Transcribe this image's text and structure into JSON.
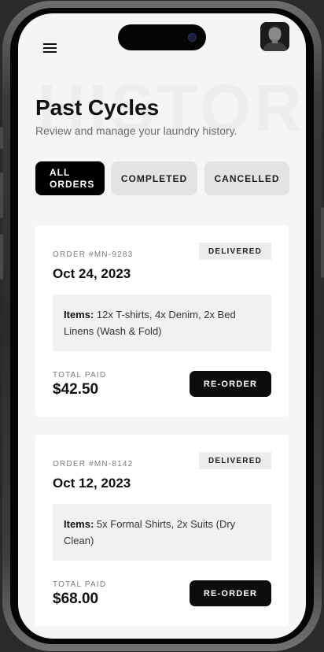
{
  "header": {
    "watermark": "HISTOR",
    "title": "Past Cycles",
    "subtitle": "Review and manage your laundry history."
  },
  "tabs": [
    {
      "label": "ALL\nORDERS",
      "active": true
    },
    {
      "label": "COMPLETED",
      "active": false
    },
    {
      "label": "CANCELLED",
      "active": false
    }
  ],
  "orders": [
    {
      "order_number": "ORDER #MN-9283",
      "status": "DELIVERED",
      "date": "Oct 24, 2023",
      "items_label": "Items:",
      "items": "12x T-shirts, 4x Denim, 2x Bed Linens (Wash & Fold)",
      "total_label": "TOTAL PAID",
      "total": "$42.50",
      "action": "RE-ORDER"
    },
    {
      "order_number": "ORDER #MN-8142",
      "status": "DELIVERED",
      "date": "Oct 12, 2023",
      "items_label": "Items:",
      "items": "5x Formal Shirts, 2x Suits (Dry Clean)",
      "total_label": "TOTAL PAID",
      "total": "$68.00",
      "action": "RE-ORDER"
    }
  ],
  "icons": {
    "menu": "hamburger-menu-icon",
    "avatar": "user-avatar"
  },
  "colors": {
    "accent": "#000000",
    "background": "#f5f5f5",
    "card": "#ffffff",
    "badge": "#ececec"
  }
}
